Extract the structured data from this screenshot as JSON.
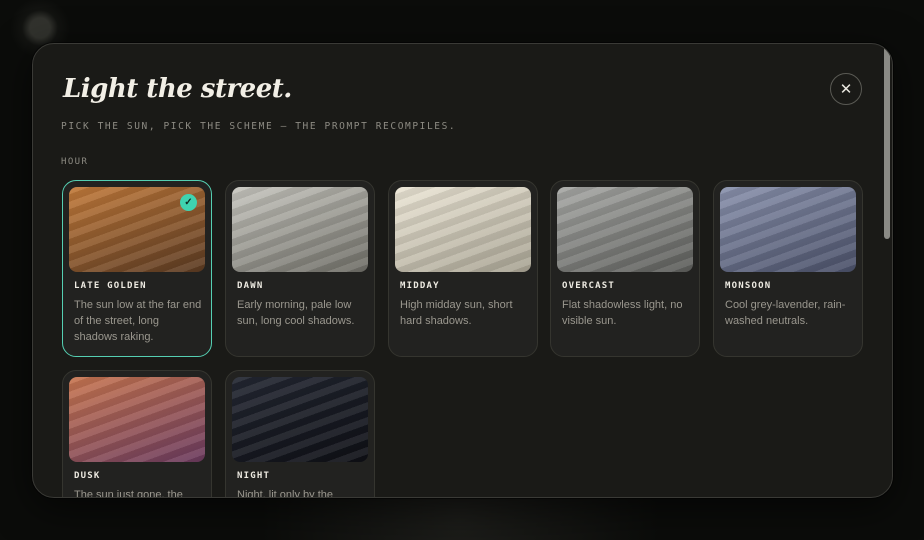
{
  "modal": {
    "title": "Light the street.",
    "subtitle": "PICK THE SUN, PICK THE SCHEME — THE PROMPT RECOMPILES.",
    "close_icon": "close-icon",
    "close_glyph": "✕"
  },
  "hour": {
    "label": "HOUR",
    "selected": "late-golden",
    "options": [
      {
        "id": "late-golden",
        "name": "LATE GOLDEN",
        "desc": "The sun low at the far end of the street, long shadows raking.",
        "gradient": [
          "#c27a3a",
          "#5a3a22"
        ],
        "selected": true
      },
      {
        "id": "dawn",
        "name": "DAWN",
        "desc": "Early morning, pale low sun, long cool shadows.",
        "gradient": [
          "#c8c7c0",
          "#6e6d66"
        ],
        "selected": false
      },
      {
        "id": "midday",
        "name": "MIDDAY",
        "desc": "High midday sun, short hard shadows.",
        "gradient": [
          "#ece6d6",
          "#a8a393"
        ],
        "selected": false
      },
      {
        "id": "overcast",
        "name": "OVERCAST",
        "desc": "Flat shadowless light, no visible sun.",
        "gradient": [
          "#a8a9a6",
          "#5c5d5a"
        ],
        "selected": false
      },
      {
        "id": "monsoon",
        "name": "MONSOON",
        "desc": "Cool grey-lavender, rain-washed neutrals.",
        "gradient": [
          "#8a92ad",
          "#4a5068"
        ],
        "selected": false
      },
      {
        "id": "dusk",
        "name": "DUSK",
        "desc": "The sun just gone, the",
        "gradient": [
          "#c87650",
          "#6a3a5e"
        ],
        "selected": false
      },
      {
        "id": "night",
        "name": "NIGHT",
        "desc": "Night, lit only by the",
        "gradient": [
          "#232732",
          "#0e0f15"
        ],
        "selected": false
      }
    ]
  },
  "colors": {
    "accent": "#3fd3b0",
    "modal_bg": "#1a1a17"
  }
}
